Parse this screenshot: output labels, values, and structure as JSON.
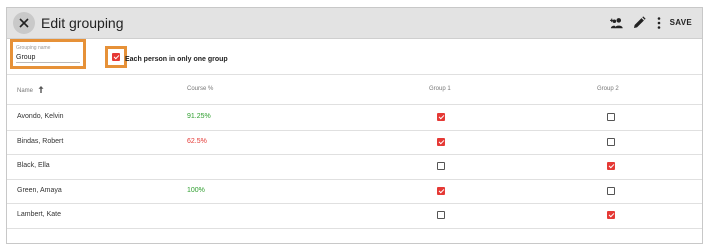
{
  "header": {
    "title": "Edit grouping",
    "save_label": "SAVE"
  },
  "grouping_name": {
    "label": "Grouping name",
    "value": "Group"
  },
  "option": {
    "label": "Each person in only one group",
    "checked": true
  },
  "table": {
    "columns": [
      "Name",
      "Course %",
      "Group 1",
      "Group 2"
    ],
    "rows": [
      {
        "name": "Avondo, Kelvin",
        "course": "91.25%",
        "course_color": "#2e9e2e",
        "g1": true,
        "g2": false
      },
      {
        "name": "Bindas, Robert",
        "course": "62.5%",
        "course_color": "#e53935",
        "g1": true,
        "g2": false
      },
      {
        "name": "Black, Ella",
        "course": "",
        "course_color": "#333333",
        "g1": false,
        "g2": true
      },
      {
        "name": "Green, Amaya",
        "course": "100%",
        "course_color": "#2e9e2e",
        "g1": true,
        "g2": false
      },
      {
        "name": "Lambert, Kate",
        "course": "",
        "course_color": "#333333",
        "g1": false,
        "g2": true
      }
    ]
  },
  "colors": {
    "accent": "#e53935",
    "highlight": "#e69138"
  },
  "icons": [
    "close-icon",
    "add-people-icon",
    "edit-pencil-icon",
    "more-vert-icon",
    "sort-arrow-up-icon"
  ]
}
